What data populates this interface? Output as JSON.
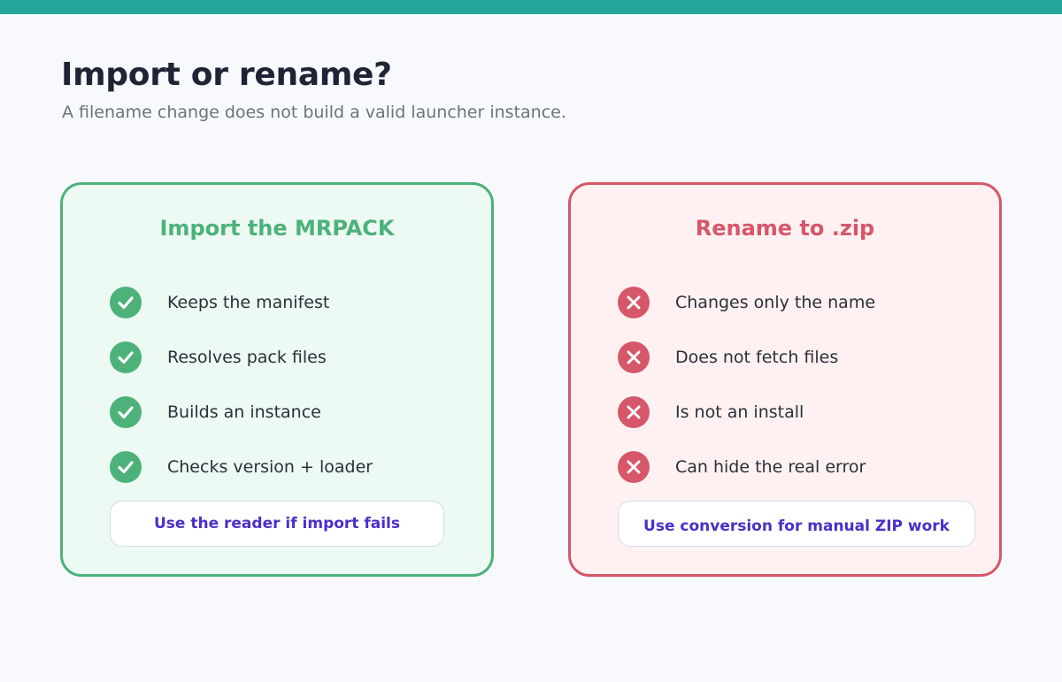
{
  "colors": {
    "accent": "#26a69a",
    "good": "#4cb27a",
    "bad": "#d6566a",
    "link": "#4a2fc9"
  },
  "header": {
    "title": "Import or rename?",
    "subtitle": "A filename change does not build a valid launcher instance."
  },
  "good": {
    "title": "Import the MRPACK",
    "icon": "check-circle-icon",
    "items": [
      "Keeps the manifest",
      "Resolves pack files",
      "Builds an instance",
      "Checks version + loader"
    ],
    "action": "Use the reader if import fails"
  },
  "bad": {
    "title": "Rename to .zip",
    "icon": "x-circle-icon",
    "items": [
      "Changes only the name",
      "Does not fetch files",
      "Is not an install",
      "Can hide the real error"
    ],
    "action": "Use conversion for manual ZIP work"
  }
}
